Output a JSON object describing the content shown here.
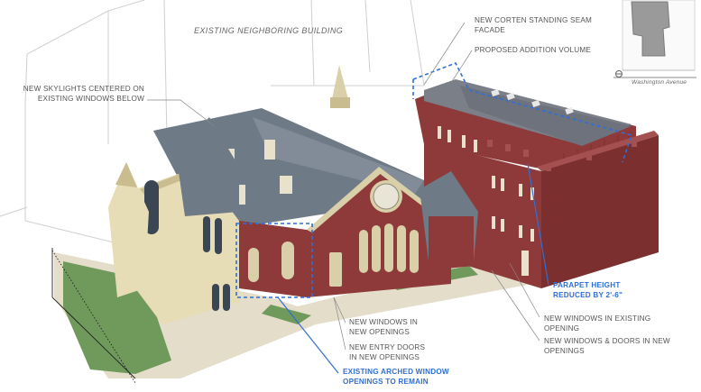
{
  "labels": {
    "neighbor": "EXISTING NEIGHBORING BUILDING",
    "skylights_1": "NEW SKYLIGHTS CENTERED ON",
    "skylights_2": "EXISTING WINDOWS BELOW",
    "corten_1": "NEW CORTEN STANDING SEAM",
    "corten_2": "FACADE",
    "addition": "PROPOSED ADDITION VOLUME",
    "windows_new_1": "NEW WINDOWS IN",
    "windows_new_2": "NEW OPENINGS",
    "entry_1": "NEW ENTRY DOORS",
    "entry_2": "IN NEW OPENINGS",
    "arched_1": "EXISTING ARCHED WINDOW",
    "arched_2": "OPENINGS TO REMAIN",
    "parapet_1": "PARAPET HEIGHT",
    "parapet_2": "REDUCED BY 2'-6\"",
    "win_exist_1": "NEW WINDOWS IN EXISTING",
    "win_exist_2": "OPENING",
    "win_doors_1": "NEW WINDOWS & DOORS IN NEW",
    "win_doors_2": "OPENINGS",
    "street": "Washington Avenue"
  },
  "colors": {
    "brick": "#8e3a3a",
    "brick_dark": "#6e2a2a",
    "roof": "#6f7a87",
    "stone": "#d9cfa8",
    "grass": "#6f9a5c",
    "callout_blue": "#2f6fd6",
    "leader": "#888888"
  },
  "icons": {
    "north_arrow": "north-arrow-icon"
  }
}
